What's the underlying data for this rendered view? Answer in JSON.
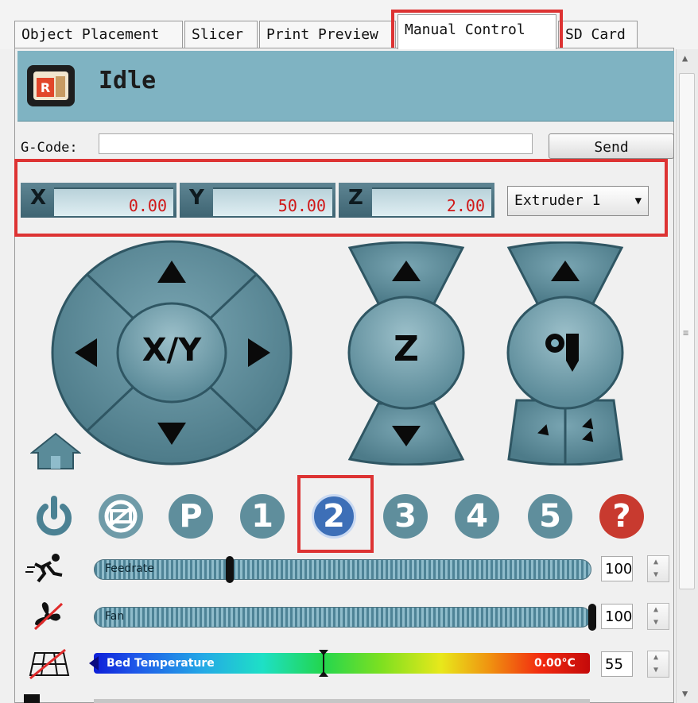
{
  "tabs": [
    "Object Placement",
    "Slicer",
    "Print Preview",
    "Manual Control",
    "SD Card"
  ],
  "active_tab": "Manual Control",
  "status": {
    "text": "Idle"
  },
  "gcode": {
    "label": "G-Code:",
    "value": "",
    "send_label": "Send"
  },
  "coords": {
    "x_label": "X",
    "x_value": "0.00",
    "y_label": "Y",
    "y_value": "50.00",
    "z_label": "Z",
    "z_value": "2.00"
  },
  "extruder_select": {
    "selected": "Extruder 1"
  },
  "jog": {
    "xy_label": "X/Y",
    "z_label": "Z"
  },
  "buttons": {
    "speed_1": "1",
    "speed_2": "2",
    "speed_3": "3",
    "speed_4": "4",
    "speed_5": "5",
    "p_label": "P",
    "help": "?"
  },
  "sliders": {
    "feedrate": {
      "label": "Feedrate",
      "value": "100",
      "level": 0.27
    },
    "fan": {
      "label": "Fan",
      "value": "100",
      "level": 1.0
    },
    "bed": {
      "label": "Bed Temperature",
      "readout": "0.00°C",
      "value": "55",
      "level": 0.46
    }
  },
  "colors": {
    "status_bar": "#7fb3c2",
    "jog_button": "#5a8b99",
    "speed_selected": "#3d6fb7",
    "help": "#c83a2f",
    "highlight": "#dd3333"
  }
}
